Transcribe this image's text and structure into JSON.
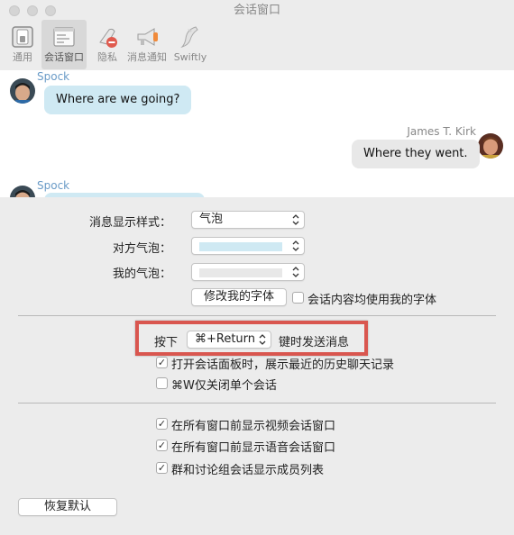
{
  "window": {
    "title": "会话窗口"
  },
  "toolbar": {
    "items": [
      {
        "label": "通用",
        "icon": "switch-icon"
      },
      {
        "label": "会话窗口",
        "icon": "chat-window-icon"
      },
      {
        "label": "隐私",
        "icon": "privacy-icon"
      },
      {
        "label": "消息通知",
        "icon": "megaphone-icon"
      },
      {
        "label": "Swiftly",
        "icon": "dolphin-icon"
      }
    ],
    "active": "会话窗口"
  },
  "preview": {
    "messages": [
      {
        "sender": "Spock",
        "text": "Where are we going?",
        "side": "left"
      },
      {
        "sender": "James T. Kirk",
        "text": "Where they went.",
        "side": "right"
      },
      {
        "sender": "Spock",
        "text": "",
        "side": "left"
      }
    ]
  },
  "settings": {
    "style_label": "消息显示样式：",
    "style_value": "气泡",
    "other_bubble_label": "对方气泡：",
    "other_bubble_color": "#cfe9f3",
    "my_bubble_label": "我的气泡：",
    "my_bubble_color": "#e8e8e8",
    "change_font_button": "修改我的字体",
    "use_my_font_label": "会话内容均使用我的字体",
    "use_my_font_checked": false,
    "send_prefix": "按下",
    "send_key_value": "⌘+Return",
    "send_suffix": "键时发送消息",
    "show_history_label": "打开会话面板时，展示最近的历史聊天记录",
    "show_history_checked": true,
    "cmd_w_label": "⌘W仅关闭单个会话",
    "cmd_w_checked": false,
    "video_front_label": "在所有窗口前显示视频会话窗口",
    "video_front_checked": true,
    "voice_front_label": "在所有窗口前显示语音会话窗口",
    "voice_front_checked": true,
    "group_members_label": "群和讨论组会话显示成员列表",
    "group_members_checked": true,
    "restore_button": "恢复默认"
  },
  "colors": {
    "accent_highlight": "#d9564f",
    "sender_name": "#6a9bc7",
    "kirk_name": "#888888",
    "other_bubble": "#cfe9f3",
    "my_bubble": "#e8e8e8"
  }
}
